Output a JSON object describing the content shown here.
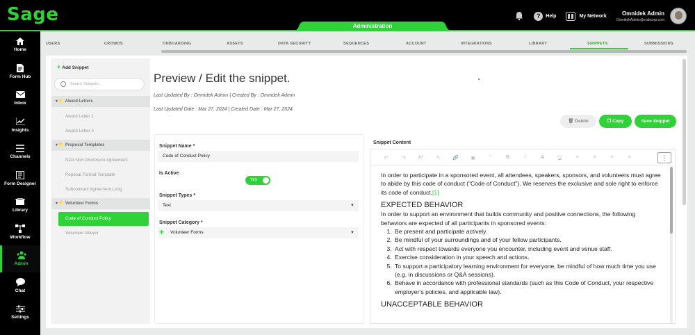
{
  "brand": {
    "logo": "Sage"
  },
  "header": {
    "admin_tab": "Administration",
    "help": "Help",
    "network": "My Network",
    "user_name": "Omnidek Admin",
    "user_email": "OmnidekAdmin@eralicorp.com"
  },
  "sidebar": {
    "items": [
      {
        "label": "Home",
        "icon": "home-icon"
      },
      {
        "label": "Form Hub",
        "icon": "document-icon"
      },
      {
        "label": "Inbox",
        "icon": "envelope-icon"
      },
      {
        "label": "Insights",
        "icon": "chart-icon"
      },
      {
        "label": "Channels",
        "icon": "channels-icon"
      },
      {
        "label": "Form Designer",
        "icon": "form-designer-icon"
      },
      {
        "label": "Library",
        "icon": "library-icon"
      },
      {
        "label": "Workflow",
        "icon": "workflow-icon"
      },
      {
        "label": "Admin",
        "icon": "admin-icon"
      },
      {
        "label": "Chat",
        "icon": "chat-icon"
      },
      {
        "label": "Settings",
        "icon": "settings-icon"
      }
    ]
  },
  "subtabs": [
    "USERS",
    "CROWDS",
    "ONBOARDING",
    "ASSETS",
    "DATA SECURITY",
    "SEQUENCES",
    "ACCOUNT",
    "INTEGRATIONS",
    "LIBRARY",
    "SNIPPETS",
    "SUBMISSIONS"
  ],
  "left": {
    "add": "Add Snippet",
    "search_placeholder": "Search Snippets...",
    "groups": [
      {
        "name": "Award Letters",
        "items": [
          "Award Letter 1",
          "Award Letter 2"
        ]
      },
      {
        "name": "Proposal Templates",
        "items": [
          "NDA Non Disclosure Agreement",
          "Poposal Format Template",
          "Subcontract Agreement Long"
        ]
      },
      {
        "name": "Volunteer Forms",
        "items": [
          "Code of Conduct Policy",
          "Volunteer Waiver"
        ]
      }
    ]
  },
  "main": {
    "title": "Preview / Edit the snippet.",
    "meta1": "Last Updated By : Omnidek Admin  |  Created By : Omnidek Admin",
    "meta2": "Last Updated Date : Mar 27, 2024  |  Created Date : Mar 27, 2024",
    "delete": "Delete",
    "copy": "Copy",
    "save": "Save Snippet"
  },
  "form": {
    "name_label": "Snippet Name *",
    "name_value": "Code of Conduct Policy",
    "active_label": "Is Active",
    "toggle_text": "YES",
    "types_label": "Snippet Types *",
    "types_value": "Text",
    "category_label": "Snippet Category *",
    "category_value": "Volunteer Forms"
  },
  "editor": {
    "label": "Snippet Content",
    "intro": "In order to participate in a sponsored event, all attendees, speakers, sponsors, and volunteers must agree to abide by this code of conduct (“Code of Conduct”). We reserves the exclusive and sole right to enforce its code of conduct.",
    "cite": "[1]",
    "h1": "EXPECTED BEHAVIOR",
    "p2": "In order to support an environment that builds community and positive connections, the following behaviors are expected of all participants in sponsored events:",
    "list": [
      "Be present and participate actively.",
      "Be mindful of your surroundings and of your fellow participants.",
      "Act with respect towards everyone you encounter, including event and venue staff.",
      "Exercise consideration in your speech and actions.",
      "To support a participatory learning environment for everyone, be mindful of how much time you use (e.g. in discussions or Q&A sessions).",
      "Behave in accordance with professional standards (such as this Code of Conduct, your respective employer’s policies, and applicable law)."
    ],
    "h2": "UNACCEPTABLE BEHAVIOR"
  },
  "colors": {
    "accent": "#31d13a",
    "topbar": "#000000"
  }
}
